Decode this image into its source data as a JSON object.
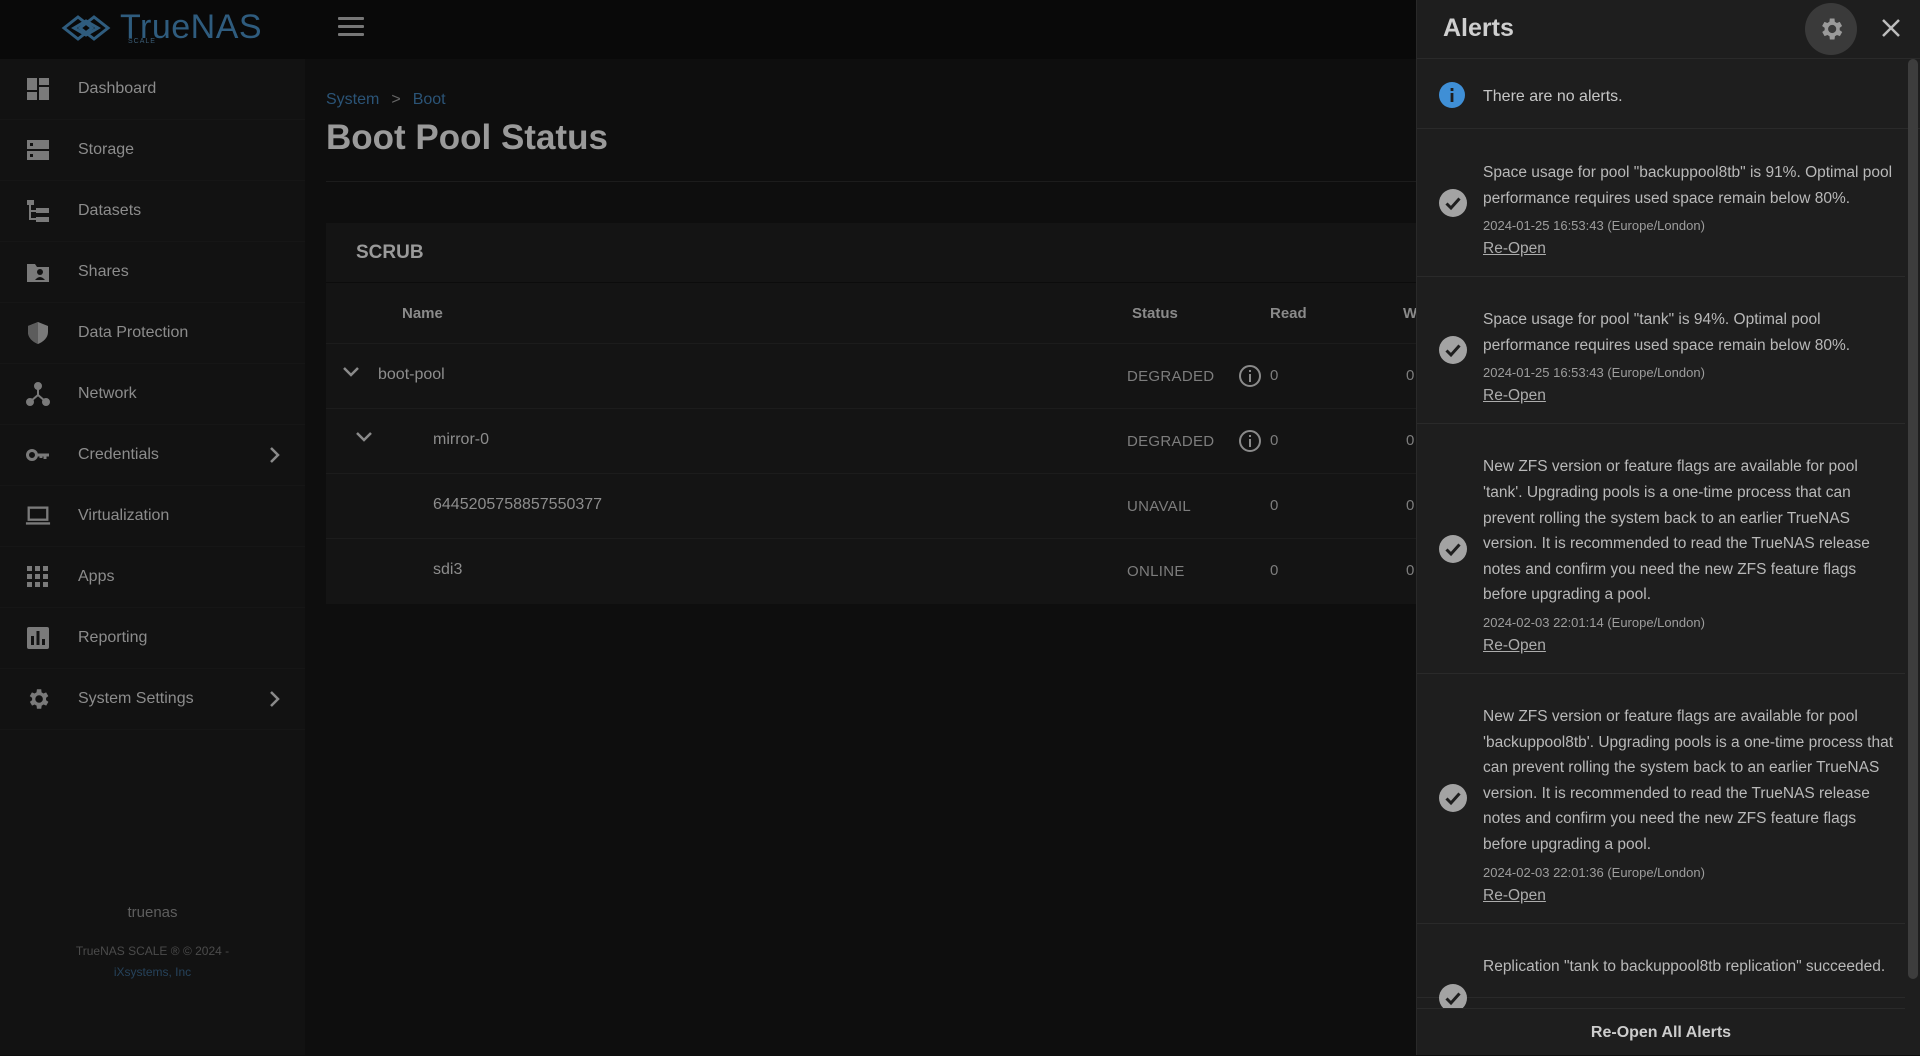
{
  "brand": {
    "name": "TrueNAS",
    "edition": "SCALE"
  },
  "sidebar": {
    "items": [
      {
        "label": "Dashboard",
        "icon": "dashboard-icon"
      },
      {
        "label": "Storage",
        "icon": "storage-icon"
      },
      {
        "label": "Datasets",
        "icon": "datasets-icon"
      },
      {
        "label": "Shares",
        "icon": "shares-icon"
      },
      {
        "label": "Data Protection",
        "icon": "shield-icon"
      },
      {
        "label": "Network",
        "icon": "network-icon"
      },
      {
        "label": "Credentials",
        "icon": "key-icon"
      },
      {
        "label": "Virtualization",
        "icon": "laptop-icon"
      },
      {
        "label": "Apps",
        "icon": "apps-grid-icon"
      },
      {
        "label": "Reporting",
        "icon": "reporting-icon"
      },
      {
        "label": "System Settings",
        "icon": "gear-icon"
      }
    ],
    "hostname": "truenas",
    "copyright": "TrueNAS SCALE ® © 2024 -",
    "company": "iXsystems, Inc"
  },
  "main": {
    "breadcrumb": [
      "System",
      "Boot"
    ],
    "title": "Boot Pool Status",
    "card_title": "SCRUB",
    "columns": [
      "Name",
      "Status",
      "Read",
      "W"
    ],
    "rows": [
      {
        "name": "boot-pool",
        "status": "DEGRADED",
        "read": "0",
        "write": "0"
      },
      {
        "name": "mirror-0",
        "status": "DEGRADED",
        "read": "0",
        "write": "0"
      },
      {
        "name": "6445205758857550377",
        "status": "UNAVAIL",
        "read": "0",
        "write": "0"
      },
      {
        "name": "sdi3",
        "status": "ONLINE",
        "read": "0",
        "write": "0"
      }
    ]
  },
  "alerts": {
    "title": "Alerts",
    "no_alerts": "There are no alerts.",
    "reopen_label": "Re-Open",
    "reopen_all": "Re-Open All Alerts",
    "items": [
      {
        "message": "Space usage for pool \"backuppool8tb\" is 91%. Optimal pool performance requires used space remain below 80%.",
        "time": "2024-01-25 16:53:43 (Europe/London)"
      },
      {
        "message": "Space usage for pool \"tank\" is 94%. Optimal pool performance requires used space remain below 80%.",
        "time": "2024-01-25 16:53:43 (Europe/London)"
      },
      {
        "message": "New ZFS version or feature flags are available for pool 'tank'. Upgrading pools is a one-time process that can prevent rolling the system back to an earlier TrueNAS version. It is recommended to read the TrueNAS release notes and confirm you need the new ZFS feature flags before upgrading a pool.",
        "time": "2024-02-03 22:01:14 (Europe/London)"
      },
      {
        "message": "New ZFS version or feature flags are available for pool 'backuppool8tb'. Upgrading pools is a one-time process that can prevent rolling the system back to an earlier TrueNAS version. It is recommended to read the TrueNAS release notes and confirm you need the new ZFS feature flags before upgrading a pool.",
        "time": "2024-02-03 22:01:36 (Europe/London)"
      },
      {
        "message": "Replication \"tank to backuppool8tb replication\" succeeded.",
        "time": ""
      }
    ]
  }
}
